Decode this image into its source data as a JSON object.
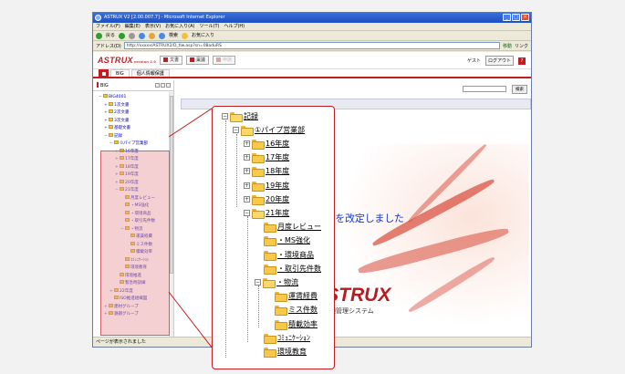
{
  "browser": {
    "title": "ASTRUX V2 [2.00.007.7] - Microsoft Internet Explorer",
    "menu": [
      "ファイル(F)",
      "編集(E)",
      "表示(V)",
      "お気に入り(A)",
      "ツール(T)",
      "ヘルプ(H)"
    ],
    "toolbar": [
      "戻る",
      "検索",
      "お気に入り"
    ],
    "address_label": "アドレス(D)",
    "address_value": "http://xxxxx/ASTRUX2/D_tlw.asp?sn=08aduRS",
    "go_label": "移動",
    "links_label": "リンク",
    "status_text": "ページが表示されました"
  },
  "app": {
    "logo": "ASTRUX",
    "version": "version 2.0",
    "tabs": [
      {
        "label": "文書",
        "enabled": true
      },
      {
        "label": "稟議",
        "enabled": true
      },
      {
        "label": "申請",
        "enabled": false
      }
    ],
    "user": "ゲスト",
    "logout_label": "ログアウト",
    "help_label": "?",
    "subtabs": [
      "BIG",
      "個人情報保護"
    ],
    "left_pane_title": "BIG",
    "search_button": "検索"
  },
  "left_tree": [
    {
      "label": "BIG4001",
      "indent": 0,
      "exp": "⊟"
    },
    {
      "label": "1次文書",
      "indent": 1,
      "exp": "⊞"
    },
    {
      "label": "2次文書",
      "indent": 1,
      "exp": "⊞"
    },
    {
      "label": "3次文書",
      "indent": 1,
      "exp": "⊞"
    },
    {
      "label": "基礎文書",
      "indent": 1,
      "exp": "⊞"
    },
    {
      "label": "記録",
      "indent": 1,
      "exp": "⊟"
    },
    {
      "label": "①パイプ営業部",
      "indent": 2,
      "exp": "⊟"
    },
    {
      "label": "16年度",
      "indent": 3,
      "exp": "⊞"
    },
    {
      "label": "17年度",
      "indent": 3,
      "exp": "⊞"
    },
    {
      "label": "18年度",
      "indent": 3,
      "exp": "⊞"
    },
    {
      "label": "19年度",
      "indent": 3,
      "exp": "⊞"
    },
    {
      "label": "20年度",
      "indent": 3,
      "exp": "⊞"
    },
    {
      "label": "21年度",
      "indent": 3,
      "exp": "⊟"
    },
    {
      "label": "月度レビュー",
      "indent": 4,
      "exp": ""
    },
    {
      "label": "・MS強化",
      "indent": 4,
      "exp": ""
    },
    {
      "label": "・環境商品",
      "indent": 4,
      "exp": ""
    },
    {
      "label": "・取引先件数",
      "indent": 4,
      "exp": ""
    },
    {
      "label": "・物流",
      "indent": 4,
      "exp": "⊟"
    },
    {
      "label": "運賃経費",
      "indent": 5,
      "exp": ""
    },
    {
      "label": "ミス件数",
      "indent": 5,
      "exp": ""
    },
    {
      "label": "積載効率",
      "indent": 5,
      "exp": ""
    },
    {
      "label": "ｺﾐｭﾆｹｰｼｮﾝ",
      "indent": 4,
      "exp": ""
    },
    {
      "label": "環境教育",
      "indent": 4,
      "exp": ""
    },
    {
      "label": "環境推進",
      "indent": 3,
      "exp": ""
    },
    {
      "label": "緊急時訓練",
      "indent": 3,
      "exp": ""
    },
    {
      "label": "22年度",
      "indent": 2,
      "exp": "⊞"
    },
    {
      "label": "ISO推進組織図",
      "indent": 2,
      "exp": ""
    },
    {
      "label": "建材グループ",
      "indent": 1,
      "exp": "⊞"
    },
    {
      "label": "鉄鋼グループ",
      "indent": 1,
      "exp": "⊞"
    }
  ],
  "callout_tree": [
    {
      "label": "記録",
      "level": 0,
      "exp": "⊟",
      "open": true
    },
    {
      "label": "①パイプ営業部",
      "level": 1,
      "exp": "⊟",
      "open": true
    },
    {
      "label": "16年度",
      "level": 2,
      "exp": "⊞",
      "open": false
    },
    {
      "label": "17年度",
      "level": 2,
      "exp": "⊞",
      "open": false
    },
    {
      "label": "18年度",
      "level": 2,
      "exp": "⊞",
      "open": false
    },
    {
      "label": "19年度",
      "level": 2,
      "exp": "⊞",
      "open": false
    },
    {
      "label": "20年度",
      "level": 2,
      "exp": "⊞",
      "open": false
    },
    {
      "label": "21年度",
      "level": 2,
      "exp": "⊟",
      "open": true
    },
    {
      "label": "月度レビュー",
      "level": 3,
      "exp": "",
      "open": false
    },
    {
      "label": "・MS強化",
      "level": 3,
      "exp": "",
      "open": false
    },
    {
      "label": "・環境商品",
      "level": 3,
      "exp": "",
      "open": false
    },
    {
      "label": "・取引先件数",
      "level": 3,
      "exp": "",
      "open": false
    },
    {
      "label": "・物流",
      "level": 3,
      "exp": "⊟",
      "open": true
    },
    {
      "label": "運賃経費",
      "level": 4,
      "exp": "",
      "open": false
    },
    {
      "label": "ミス件数",
      "level": 4,
      "exp": "",
      "open": false
    },
    {
      "label": "積載効率",
      "level": 4,
      "exp": "",
      "open": false
    },
    {
      "label": "ｺﾐｭﾆｹｰｼｮﾝ",
      "level": 3,
      "exp": "",
      "open": false
    },
    {
      "label": "環境教育",
      "level": 3,
      "exp": "",
      "open": false
    }
  ],
  "main": {
    "announcement": "『書類管理手順書』を改定しました",
    "splash_logo": "ASTRUX",
    "splash_sub": "書類管理システム"
  },
  "colors": {
    "brand_red": "#c31d22",
    "link_blue": "#1535c8",
    "highlight_pink": "#e6969b"
  }
}
